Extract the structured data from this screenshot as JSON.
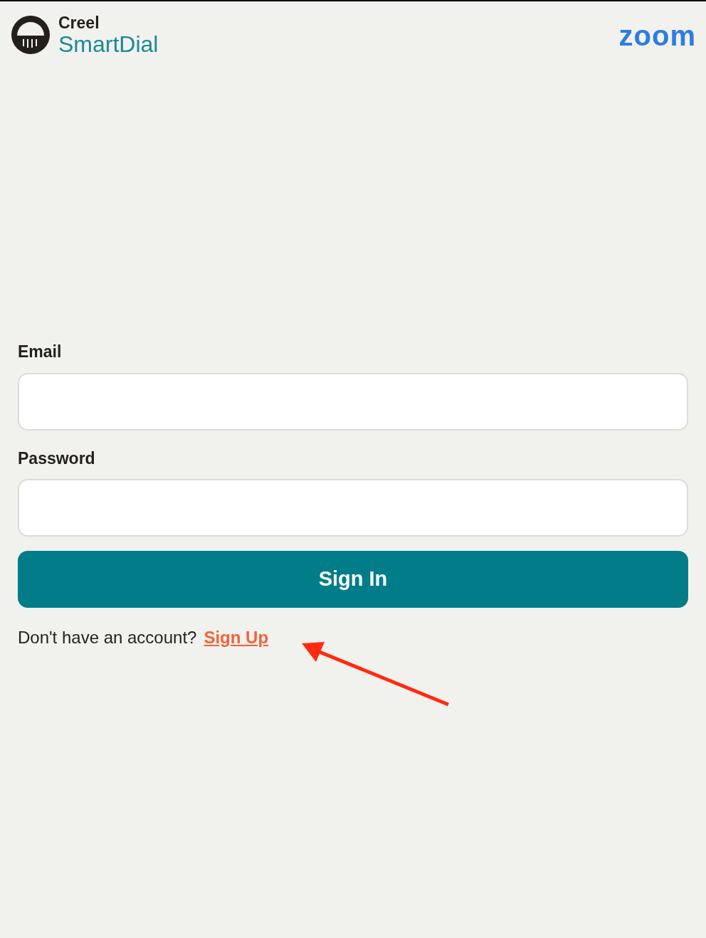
{
  "header": {
    "brand_top": "Creel",
    "brand_name": "SmartDial",
    "partner_logo": "zoom"
  },
  "form": {
    "fields": [
      {
        "label": "Email"
      },
      {
        "label": "Password"
      }
    ],
    "submit": "Sign In",
    "signup_prompt": "Don't have an account?",
    "signup_link": "Sign Up"
  }
}
